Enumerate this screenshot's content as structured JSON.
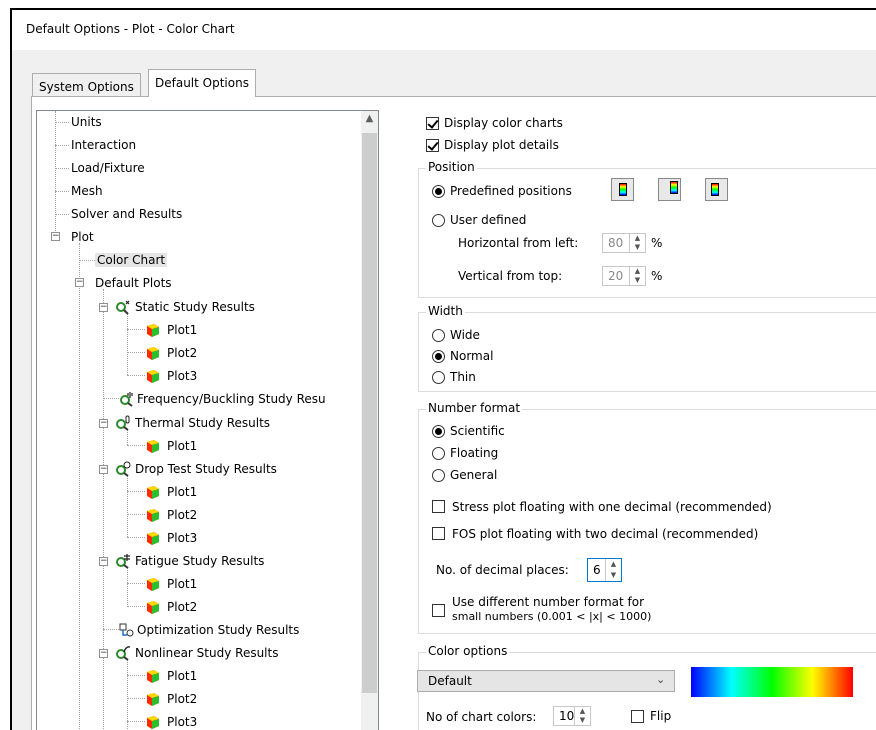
{
  "window": {
    "title": "Default Options - Plot - Color Chart"
  },
  "tabs": [
    {
      "label": "System Options"
    },
    {
      "label": "Default Options"
    }
  ],
  "tree": {
    "items": [
      {
        "label": "Units"
      },
      {
        "label": "Interaction"
      },
      {
        "label": "Load/Fixture"
      },
      {
        "label": "Mesh"
      },
      {
        "label": "Solver and Results"
      },
      {
        "label": "Plot"
      },
      {
        "label": "Color Chart"
      },
      {
        "label": "Default Plots"
      },
      {
        "label": "Static Study Results"
      },
      {
        "label": "Plot1"
      },
      {
        "label": "Plot2"
      },
      {
        "label": "Plot3"
      },
      {
        "label": "Frequency/Buckling Study Resu"
      },
      {
        "label": "Thermal Study Results"
      },
      {
        "label": "Plot1"
      },
      {
        "label": "Drop Test Study Results"
      },
      {
        "label": "Plot1"
      },
      {
        "label": "Plot2"
      },
      {
        "label": "Plot3"
      },
      {
        "label": "Fatigue Study Results"
      },
      {
        "label": "Plot1"
      },
      {
        "label": "Plot2"
      },
      {
        "label": "Optimization Study Results"
      },
      {
        "label": "Nonlinear Study Results"
      },
      {
        "label": "Plot1"
      },
      {
        "label": "Plot2"
      },
      {
        "label": "Plot3"
      }
    ]
  },
  "options": {
    "display_color_charts": "Display color charts",
    "display_plot_details": "Display plot details",
    "position": {
      "title": "Position",
      "predefined": "Predefined positions",
      "user_defined": "User defined",
      "horizontal_label": "Horizontal from left:",
      "horizontal_value": "80",
      "vertical_label": "Vertical from top:",
      "vertical_value": "20",
      "unit": "%"
    },
    "width": {
      "title": "Width",
      "wide": "Wide",
      "normal": "Normal",
      "thin": "Thin"
    },
    "number_format": {
      "title": "Number format",
      "scientific": "Scientific",
      "floating": "Floating",
      "general": "General",
      "stress_floating": "Stress plot floating with one decimal (recommended)",
      "fos_floating": "FOS plot floating with two decimal (recommended)",
      "decimal_places_label": "No. of decimal places:",
      "decimal_places_value": "6",
      "different_format_line1": "Use different number format for",
      "different_format_line2": "small numbers (0.001 < |x| < 1000)"
    },
    "color_options": {
      "title": "Color options",
      "selected": "Default",
      "chart_colors_label": "No of chart colors:",
      "chart_colors_value": "10",
      "flip": "Flip"
    }
  },
  "colors": {
    "accent_selection": "#e5e5e5",
    "spectrum": [
      "#0000ff",
      "#00ffff",
      "#00ff00",
      "#ffff00",
      "#ff0000"
    ]
  }
}
